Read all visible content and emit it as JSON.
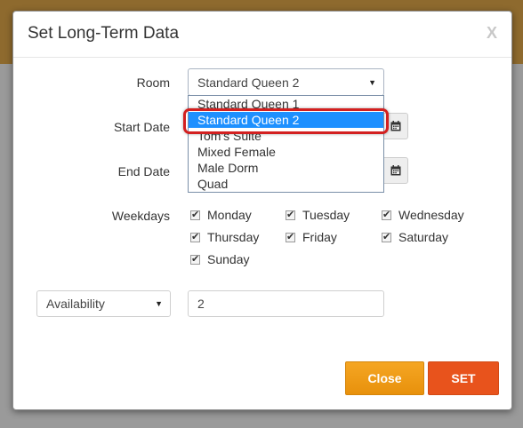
{
  "modal": {
    "title": "Set Long-Term Data",
    "close_icon": "X"
  },
  "room": {
    "label": "Room",
    "value": "Standard Queen 2",
    "options": [
      "Standard Queen 1",
      "Standard Queen 2",
      "Tom's Suite",
      "Mixed Female",
      "Male Dorm",
      "Quad"
    ],
    "selected_index": 1
  },
  "start_date": {
    "label": "Start Date"
  },
  "end_date": {
    "label": "End Date"
  },
  "weekdays": {
    "label": "Weekdays",
    "days": [
      {
        "label": "Monday",
        "checked": true
      },
      {
        "label": "Tuesday",
        "checked": true
      },
      {
        "label": "Wednesday",
        "checked": true
      },
      {
        "label": "Thursday",
        "checked": true
      },
      {
        "label": "Friday",
        "checked": true
      },
      {
        "label": "Saturday",
        "checked": true
      },
      {
        "label": "Sunday",
        "checked": true
      }
    ]
  },
  "availability": {
    "select_value": "Availability",
    "input_value": "2"
  },
  "buttons": {
    "close": "Close",
    "set": "SET"
  },
  "colors": {
    "close_button": "#f0a01a",
    "set_button": "#e8531c",
    "selected_option": "#1e90ff",
    "highlight_ring": "#d32020"
  }
}
